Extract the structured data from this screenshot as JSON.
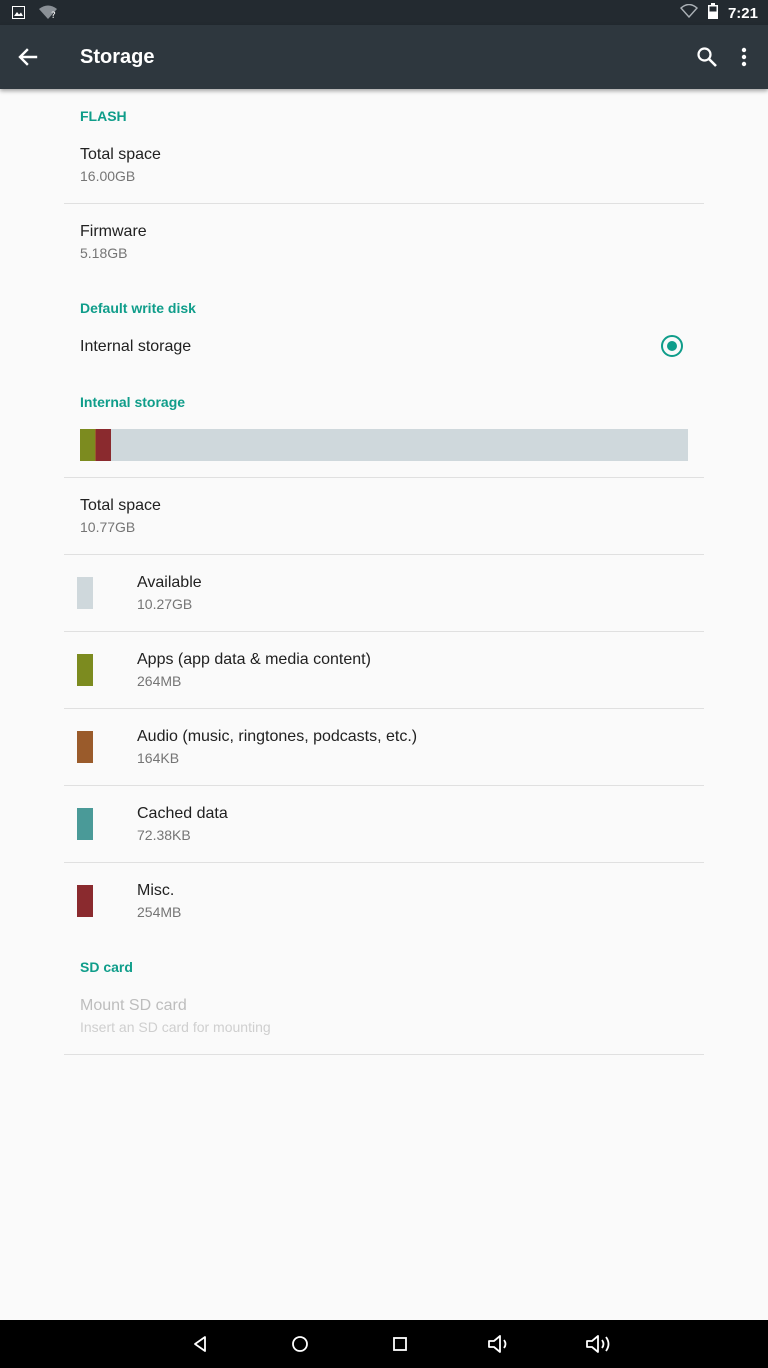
{
  "status_bar": {
    "time": "7:21",
    "icons": [
      "image-icon",
      "wifi-question-icon",
      "wifi-icon",
      "battery-icon"
    ]
  },
  "app_bar": {
    "title": "Storage",
    "icons": [
      "back-arrow-icon",
      "search-icon",
      "more-vert-icon"
    ]
  },
  "flash": {
    "header": "FLASH",
    "total_space": {
      "title": "Total space",
      "value": "16.00GB"
    },
    "firmware": {
      "title": "Firmware",
      "value": "5.18GB"
    }
  },
  "default_write_disk": {
    "header": "Default write disk",
    "option": {
      "label": "Internal storage",
      "selected": true
    }
  },
  "internal_storage": {
    "header": "Internal storage",
    "usage_bar": [
      {
        "name": "Apps",
        "fraction": 0.0245,
        "color": "#7c8b1f"
      },
      {
        "name": "Audio",
        "fraction": 0.0015,
        "color": "#9a5b2b"
      },
      {
        "name": "Cached data",
        "fraction": 0.0007,
        "color": "#4a9a98"
      },
      {
        "name": "Misc.",
        "fraction": 0.0236,
        "color": "#8a2a2e"
      },
      {
        "name": "Available",
        "fraction": 0.9497,
        "color": "#cfd8dc"
      }
    ],
    "total_space": {
      "title": "Total space",
      "value": "10.77GB"
    },
    "categories": [
      {
        "title": "Available",
        "value": "10.27GB",
        "color": "#cfd8dc"
      },
      {
        "title": "Apps (app data & media content)",
        "value": "264MB",
        "color": "#7c8b1f"
      },
      {
        "title": "Audio (music, ringtones, podcasts, etc.)",
        "value": "164KB",
        "color": "#9a5b2b"
      },
      {
        "title": "Cached data",
        "value": "72.38KB",
        "color": "#4a9a98"
      },
      {
        "title": "Misc.",
        "value": "254MB",
        "color": "#8a2a2e"
      }
    ]
  },
  "sd_card": {
    "header": "SD card",
    "mount": {
      "title": "Mount SD card",
      "subtitle": "Insert an SD card for mounting",
      "enabled": false
    }
  },
  "nav_bar": {
    "buttons": [
      "back-icon",
      "home-icon",
      "recents-icon",
      "volume-down-icon",
      "volume-up-icon"
    ]
  },
  "colors": {
    "accent": "#0f9d8a",
    "app_bar": "#2e373e",
    "status_bar": "#232a30"
  }
}
